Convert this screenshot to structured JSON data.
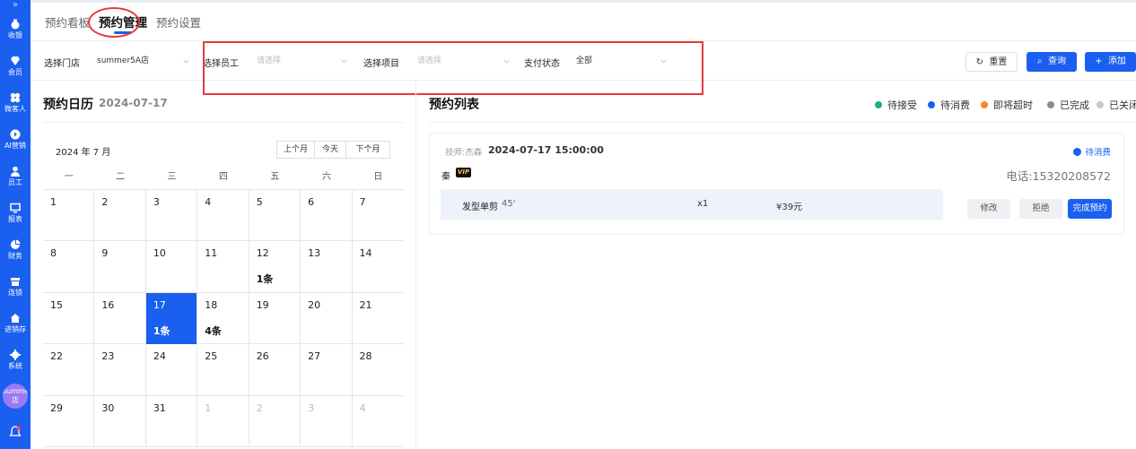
{
  "sidebar": {
    "items": [
      {
        "label": "收银",
        "icon": "cashier-icon"
      },
      {
        "label": "会员",
        "icon": "diamond-icon"
      },
      {
        "label": "微客人",
        "icon": "clover-icon"
      },
      {
        "label": "AI营销",
        "icon": "play-icon"
      },
      {
        "label": "员工",
        "icon": "person-icon"
      },
      {
        "label": "报表",
        "icon": "monitor-icon"
      },
      {
        "label": "财务",
        "icon": "pie-icon"
      },
      {
        "label": "连锁",
        "icon": "store-icon"
      },
      {
        "label": "进销存",
        "icon": "home-icon"
      },
      {
        "label": "系统",
        "icon": "gear-icon"
      }
    ],
    "store_badge": "summerSA店"
  },
  "tabs": [
    "预约看板",
    "预约管理",
    "预约设置"
  ],
  "filters": {
    "store_label": "选择门店",
    "store_value": "summer5A店",
    "staff_label": "选择员工",
    "staff_placeholder": "请选择",
    "project_label": "选择项目",
    "project_placeholder": "请选择",
    "pay_label": "支付状态",
    "pay_value": "全部",
    "reset": "重置",
    "query": "查询",
    "add": "添加"
  },
  "calendar": {
    "title": "预约日历",
    "date": "2024-07-17",
    "month_label": "2024 年 7 月",
    "prev": "上个月",
    "today": "今天",
    "next": "下个月",
    "weekdays": [
      "一",
      "二",
      "三",
      "四",
      "五",
      "六",
      "日"
    ],
    "weeks": [
      [
        {
          "d": "1"
        },
        {
          "d": "2"
        },
        {
          "d": "3"
        },
        {
          "d": "4"
        },
        {
          "d": "5"
        },
        {
          "d": "6"
        },
        {
          "d": "7"
        }
      ],
      [
        {
          "d": "8"
        },
        {
          "d": "9"
        },
        {
          "d": "10"
        },
        {
          "d": "11"
        },
        {
          "d": "12",
          "c": "1条"
        },
        {
          "d": "13"
        },
        {
          "d": "14"
        }
      ],
      [
        {
          "d": "15"
        },
        {
          "d": "16"
        },
        {
          "d": "17",
          "c": "1条",
          "sel": true
        },
        {
          "d": "18",
          "c": "4条"
        },
        {
          "d": "19"
        },
        {
          "d": "20"
        },
        {
          "d": "21"
        }
      ],
      [
        {
          "d": "22"
        },
        {
          "d": "23"
        },
        {
          "d": "24"
        },
        {
          "d": "25"
        },
        {
          "d": "26"
        },
        {
          "d": "27"
        },
        {
          "d": "28"
        }
      ],
      [
        {
          "d": "29"
        },
        {
          "d": "30"
        },
        {
          "d": "31"
        },
        {
          "d": "1",
          "o": true
        },
        {
          "d": "2",
          "o": true
        },
        {
          "d": "3",
          "o": true
        },
        {
          "d": "4",
          "o": true
        }
      ]
    ]
  },
  "list": {
    "title": "预约列表",
    "legend": [
      {
        "label": "待接受",
        "color": "#14b37d"
      },
      {
        "label": "待消费",
        "color": "#1a5ff0"
      },
      {
        "label": "即将超时",
        "color": "#f08a2e"
      },
      {
        "label": "已完成",
        "color": "#8c8c8c"
      },
      {
        "label": "已关闭",
        "color": "#c8c8c8"
      }
    ],
    "card": {
      "technician": "技师:杰森",
      "time": "2024-07-17 15:00:00",
      "status": "待消费",
      "customer": "秦",
      "vip": "VIP",
      "phone": "电话:15320208572",
      "service_name": "发型单剪",
      "service_duration": "45'",
      "quantity": "x1",
      "price": "¥39元",
      "edit": "修改",
      "reject": "拒绝",
      "complete": "完成预约"
    }
  },
  "colors": {
    "primary": "#1a5ff0",
    "annotation": "#e63a3a"
  }
}
